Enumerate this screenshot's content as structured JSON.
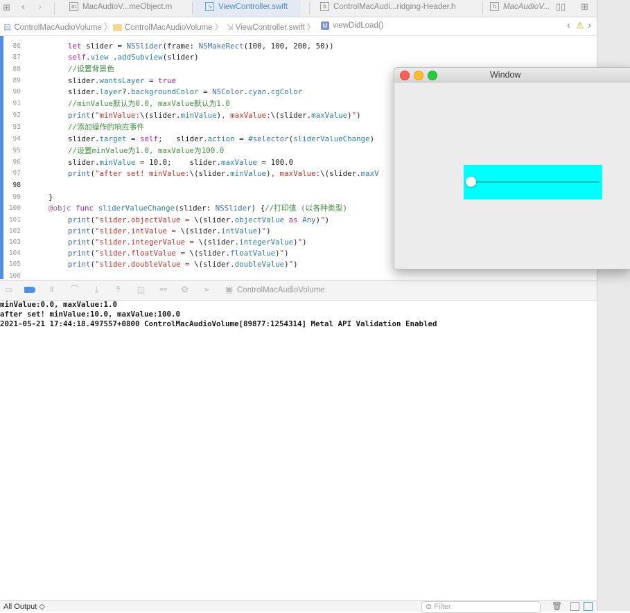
{
  "tabs": [
    {
      "label": "MacAudioV...meObject.m",
      "icon": "m"
    },
    {
      "label": "ViewController.swift",
      "icon": "swift"
    },
    {
      "label": "ControlMacAudi...ridging-Header.h",
      "icon": "h"
    },
    {
      "label": "MacAudioV...",
      "icon": "h"
    }
  ],
  "breadcrumb": {
    "project": "ControlMacAudioVolume",
    "group": "ControlMacAudioVolume",
    "file": "ViewController.swift",
    "symbol": "viewDidLoad()",
    "symbol_badge": "M"
  },
  "code": {
    "current_line": "98",
    "lines": [
      {
        "n": "86",
        "t": "        let slider = NSSlider(frame: NSMakeRect(100, 100, 200, 50))"
      },
      {
        "n": "87",
        "t": "        self.view .addSubview(slider)"
      },
      {
        "n": "88",
        "t": "        //设置背景色"
      },
      {
        "n": "89",
        "t": "        slider.wantsLayer = true"
      },
      {
        "n": "90",
        "t": "        slider.layer?.backgroundColor = NSColor.cyan.cgColor"
      },
      {
        "n": "91",
        "t": "        //minValue默认为0.0, maxValue默认为1.0"
      },
      {
        "n": "92",
        "t": "        print(\"minValue:\\(slider.minValue), maxValue:\\(slider.maxValue)\")"
      },
      {
        "n": "93",
        "t": "        //添加操作的响应事件"
      },
      {
        "n": "94",
        "t": "        slider.target = self;   slider.action = #selector(sliderValueChange)"
      },
      {
        "n": "95",
        "t": "        //设置minValue为1.0, maxValue为100.0"
      },
      {
        "n": "96",
        "t": "        slider.minValue = 10.0;    slider.maxValue = 100.0"
      },
      {
        "n": "97",
        "t": "        print(\"after set! minValue:\\(slider.minValue), maxValue:\\(slider.maxV"
      },
      {
        "n": "98",
        "t": ""
      },
      {
        "n": "99",
        "t": "    }"
      },
      {
        "n": "100",
        "t": "    @objc func sliderValueChange(slider: NSSlider) {//打印值 (以各种类型)"
      },
      {
        "n": "101",
        "t": "        print(\"slider.objectValue = \\(slider.objectValue as Any)\")"
      },
      {
        "n": "102",
        "t": "        print(\"slider.intValue = \\(slider.intValue)\")"
      },
      {
        "n": "103",
        "t": "        print(\"slider.integerValue = \\(slider.integerValue)\")"
      },
      {
        "n": "104",
        "t": "        print(\"slider.floatValue = \\(slider.floatValue)\")"
      },
      {
        "n": "105",
        "t": "        print(\"slider.doubleValue = \\(slider.doubleValue)\")"
      },
      {
        "n": "106",
        "t": ""
      }
    ]
  },
  "debug_bar": {
    "target": "ControlMacAudioVolume"
  },
  "console": {
    "lines": [
      "minValue:0.0, maxValue:1.0",
      "after set! minValue:10.0, maxValue:100.0",
      "2021-05-21 17:44:18.497557+0800 ControlMacAudioVolume[89877:1254314] Metal API Validation Enabled"
    ]
  },
  "bottom_bar": {
    "output_selector": "All Output ◇",
    "filter_placeholder": "Filter"
  },
  "app_window": {
    "title": "Window",
    "slider": {
      "min": 10.0,
      "max": 100.0,
      "value": 10.0,
      "background": "#00ffff"
    }
  },
  "colors": {
    "accent": "#4f8fe8",
    "keyword": "#b0259e",
    "string": "#c4302a",
    "comment": "#3f8f3f",
    "type": "#3f6fb0"
  }
}
